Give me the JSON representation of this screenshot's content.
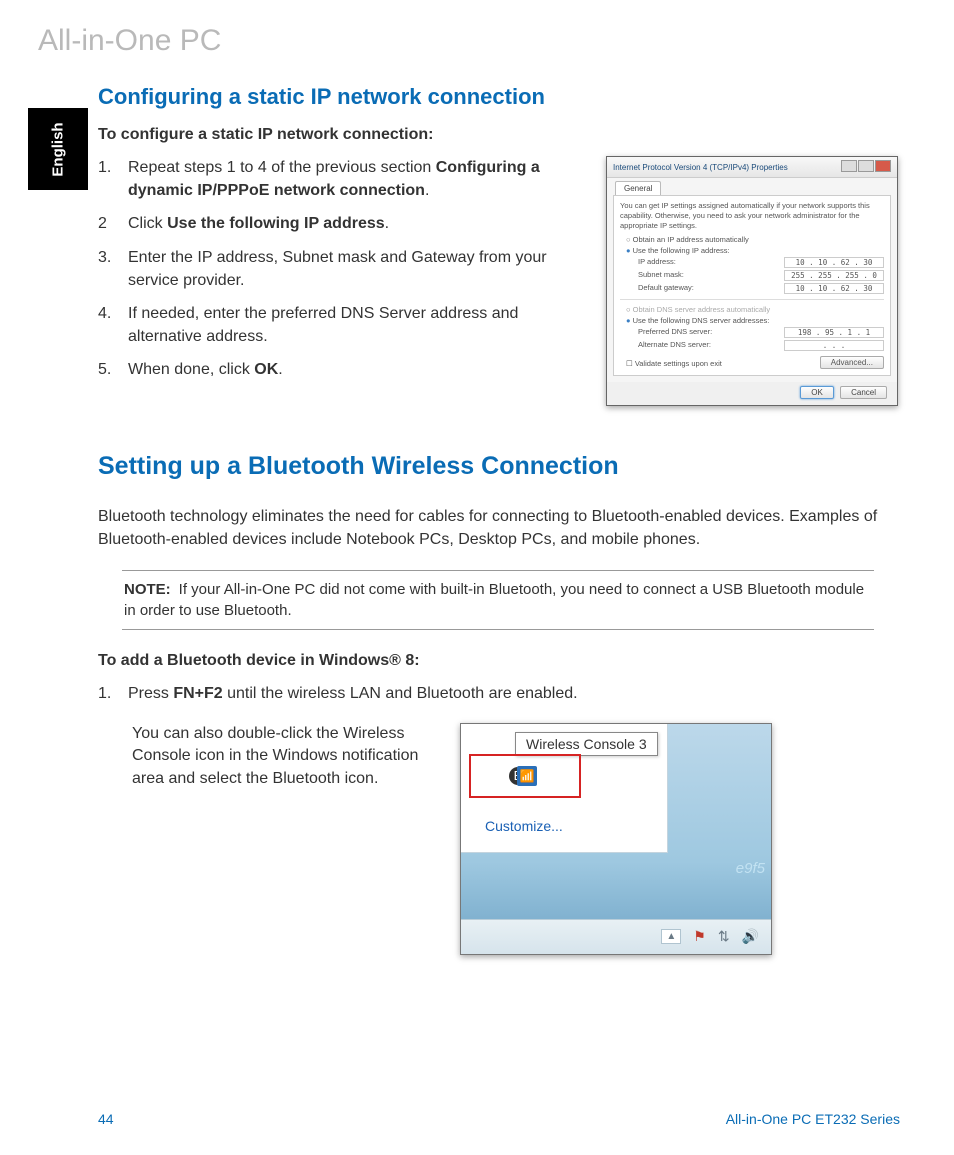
{
  "header": {
    "product_line": "All-in-One PC"
  },
  "language_tab": "English",
  "section_static": {
    "heading": "Configuring a static IP network connection",
    "intro_bold": "To configure a static IP network connection:",
    "steps": [
      {
        "num": "1.",
        "before": "Repeat steps 1 to 4 of the previous section ",
        "bold": "Configuring a dynamic IP/PPPoE network connection",
        "after": "."
      },
      {
        "num": "2",
        "before": "Click ",
        "bold": "Use the following IP address",
        "after": "."
      },
      {
        "num": "3.",
        "before": "Enter the IP address, Subnet mask and Gateway from your service provider.",
        "bold": "",
        "after": ""
      },
      {
        "num": "4.",
        "before": "If needed, enter the preferred DNS Server address and alternative address.",
        "bold": "",
        "after": ""
      },
      {
        "num": "5.",
        "before": "When done, click ",
        "bold": "OK",
        "after": "."
      }
    ]
  },
  "dialog": {
    "title": "Internet Protocol Version 4 (TCP/IPv4) Properties",
    "tab": "General",
    "desc": "You can get IP settings assigned automatically if your network supports this capability. Otherwise, you need to ask your network administrator for the appropriate IP settings.",
    "radio_auto_ip": "Obtain an IP address automatically",
    "radio_use_ip": "Use the following IP address:",
    "ip_label": "IP address:",
    "ip_val": "10 . 10 . 62 . 30",
    "mask_label": "Subnet mask:",
    "mask_val": "255 . 255 . 255 . 0",
    "gw_label": "Default gateway:",
    "gw_val": "10 . 10 . 62 . 30",
    "radio_auto_dns": "Obtain DNS server address automatically",
    "radio_use_dns": "Use the following DNS server addresses:",
    "pdns_label": "Preferred DNS server:",
    "pdns_val": "198 . 95 . 1 . 1",
    "adns_label": "Alternate DNS server:",
    "adns_val": " .  .  . ",
    "validate": "Validate settings upon exit",
    "advanced": "Advanced...",
    "ok": "OK",
    "cancel": "Cancel"
  },
  "section_bt": {
    "heading": "Setting up a Bluetooth Wireless Connection",
    "intro": "Bluetooth technology eliminates the need for cables for connecting to Bluetooth-enabled devices. Examples of Bluetooth-enabled devices include Notebook PCs, Desktop PCs, and mobile phones.",
    "note_label": "NOTE:",
    "note_text": "If your All-in-One PC did not come with built-in Bluetooth, you need to connect a USB Bluetooth module in order to use Bluetooth.",
    "add_heading": "To add a Bluetooth device in Windows® 8:",
    "step1_num": "1.",
    "step1_before": "Press ",
    "step1_bold": "FN+F2",
    "step1_after": " until the wireless LAN and Bluetooth are enabled.",
    "console_hint": "You can also double-click the Wireless Console icon in the Windows notification area and select the Bluetooth icon."
  },
  "console": {
    "tooltip": "Wireless Console 3",
    "customize": "Customize...",
    "hash": "e9f5",
    "wifi_glyph": "📶",
    "bt_glyph": "B",
    "tray_up": "▲",
    "tray_flag": "⚑",
    "tray_net": "⇅",
    "tray_vol": "🔊"
  },
  "footer": {
    "page": "44",
    "series": "All-in-One PC ET232 Series"
  }
}
